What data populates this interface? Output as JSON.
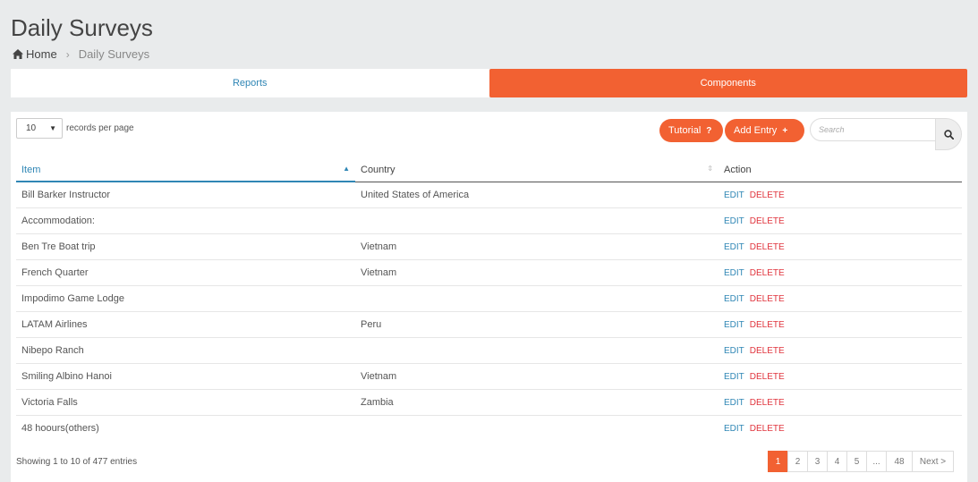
{
  "header": {
    "title": "Daily Surveys",
    "breadcrumb": {
      "home": "Home",
      "current": "Daily Surveys"
    }
  },
  "tabs": [
    {
      "label": "Reports",
      "active": false
    },
    {
      "label": "Components",
      "active": true
    }
  ],
  "toolbar": {
    "length_value": "10",
    "length_suffix": "records per page",
    "tutorial_label": "Tutorial",
    "tutorial_icon": "?",
    "add_label": "Add Entry",
    "add_icon": "+",
    "search_placeholder": "Search"
  },
  "table": {
    "columns": [
      "Item",
      "Country",
      "Action"
    ],
    "rows": [
      {
        "item": "Bill Barker Instructor",
        "country": "United States of America"
      },
      {
        "item": "Accommodation:",
        "country": ""
      },
      {
        "item": "Ben Tre Boat trip",
        "country": "Vietnam"
      },
      {
        "item": "French Quarter",
        "country": "Vietnam"
      },
      {
        "item": "Impodimo Game Lodge",
        "country": ""
      },
      {
        "item": "LATAM Airlines",
        "country": "Peru"
      },
      {
        "item": "Nibepo Ranch",
        "country": ""
      },
      {
        "item": "Smiling Albino Hanoi",
        "country": "Vietnam"
      },
      {
        "item": "Victoria Falls",
        "country": "Zambia"
      },
      {
        "item": "48 hoours(others)",
        "country": ""
      }
    ],
    "edit_label": "EDIT",
    "delete_label": "DELETE"
  },
  "footer": {
    "info": "Showing 1 to 10 of 477 entries",
    "pages": [
      "1",
      "2",
      "3",
      "4",
      "5",
      "...",
      "48"
    ],
    "next_label": "Next >"
  },
  "colors": {
    "accent": "#f26132",
    "link": "#2f86b5",
    "danger": "#e0343d"
  }
}
